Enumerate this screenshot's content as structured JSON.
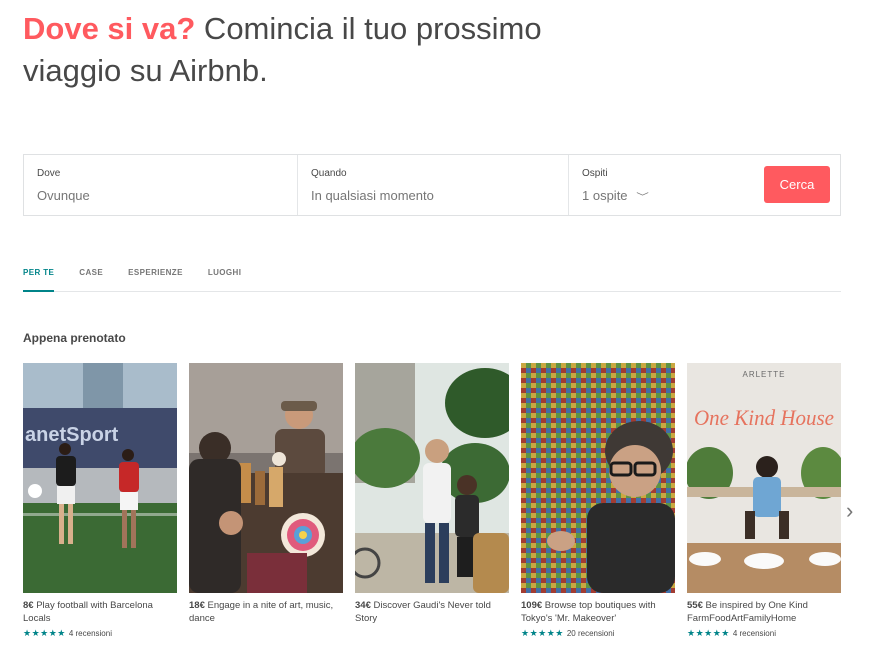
{
  "hero": {
    "accent": "Dove si va?",
    "rest": " Comincia il tuo prossimo viaggio su Airbnb."
  },
  "search": {
    "where_label": "Dove",
    "where_value": "Ovunque",
    "when_label": "Quando",
    "when_value": "In qualsiasi momento",
    "guests_label": "Ospiti",
    "guests_value": "1 ospite",
    "button_label": "Cerca"
  },
  "tabs": [
    {
      "label": "PER TE",
      "active": true
    },
    {
      "label": "CASE",
      "active": false
    },
    {
      "label": "ESPERIENZE",
      "active": false
    },
    {
      "label": "LUOGHI",
      "active": false
    }
  ],
  "section_title": "Appena prenotato",
  "cards": [
    {
      "price": "8€",
      "title": "Play football with Barcelona Locals",
      "reviews": "4 recensioni",
      "stars": "★★★★★"
    },
    {
      "price": "18€",
      "title": "Engage in a nite of art, music, dance",
      "reviews": "",
      "stars": ""
    },
    {
      "price": "34€",
      "title": "Discover Gaudi's Never told Story",
      "reviews": "",
      "stars": ""
    },
    {
      "price": "109€",
      "title": "Browse top boutiques with Tokyo's 'Mr. Makeover'",
      "reviews": "20 recensioni",
      "stars": "★★★★★"
    },
    {
      "price": "55€",
      "title": "Be inspired by One Kind FarmFoodArtFamilyHome",
      "reviews": "4 recensioni",
      "stars": "★★★★★"
    }
  ],
  "card_image_text": {
    "banner": "anetSport",
    "arlette": "ARLETTE",
    "one_kind_house": "One Kind House"
  },
  "colors": {
    "brand": "#ff5a5f",
    "teal": "#008489",
    "text": "#484848"
  },
  "icons": {
    "guests_chevron": "chevron-down-icon",
    "carousel_next": "chevron-right-icon",
    "rating": "star-icon"
  }
}
